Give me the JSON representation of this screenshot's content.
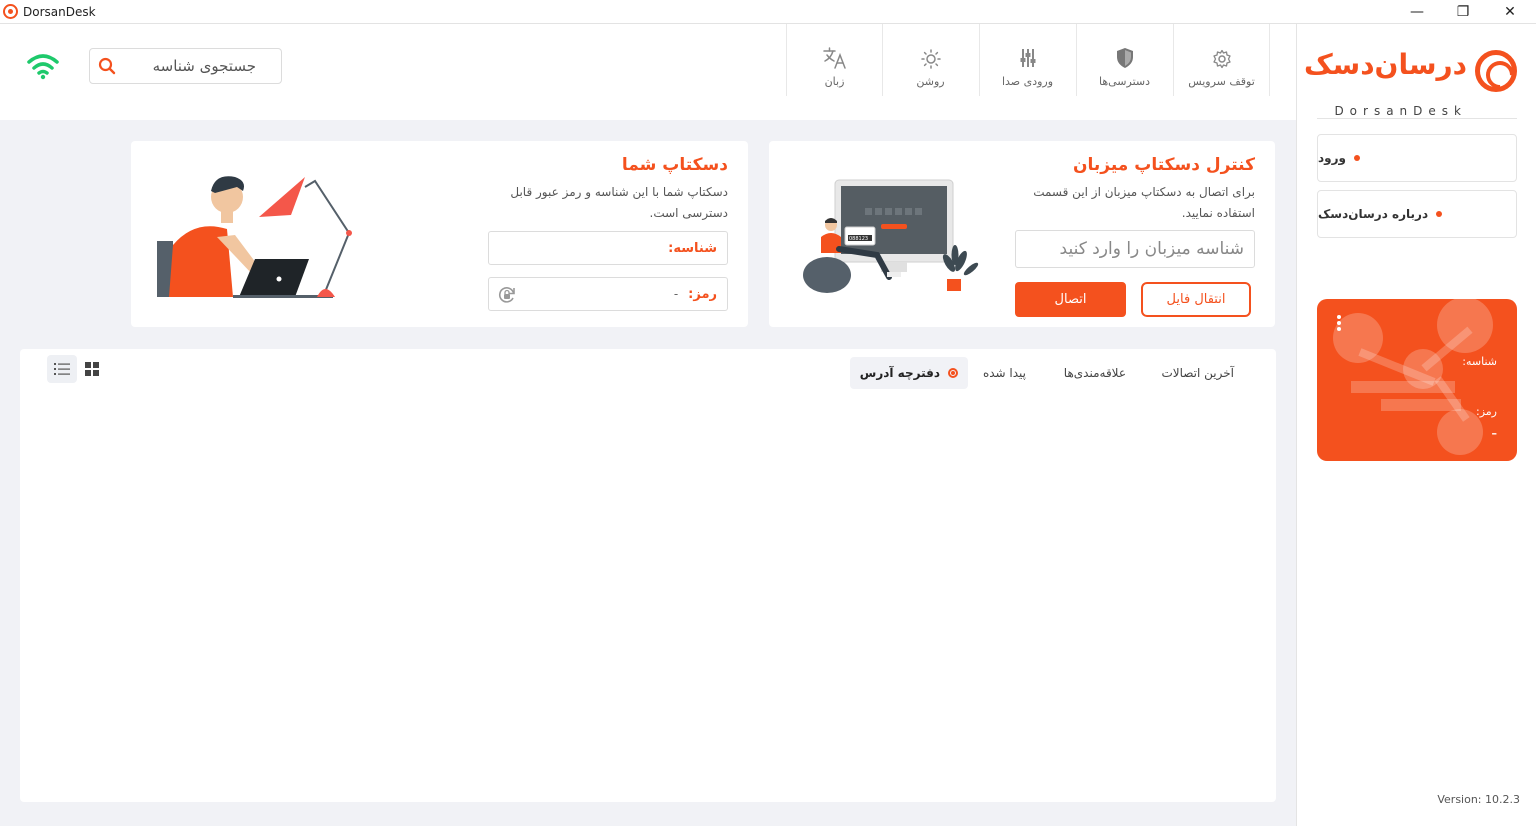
{
  "window": {
    "title": "DorsanDesk",
    "minimize": "—",
    "restore": "❐",
    "close": "✕"
  },
  "brand": {
    "name_fa": "درسان‌دسک",
    "name_en": "DorsanDesk"
  },
  "sidebar": {
    "items": [
      {
        "label": "ورود"
      },
      {
        "label": "درباره درسان‌دسک"
      }
    ],
    "id_card": {
      "id_label": "شناسه:",
      "password_label": "رمز:",
      "password_value": "–"
    },
    "version": "Version: 10.2.3"
  },
  "toolbar": {
    "search_placeholder": "جستجوی شناسه",
    "buttons": [
      {
        "label": "توقف سرویس",
        "icon": "gear-icon"
      },
      {
        "label": "دسترسی‌ها",
        "icon": "shield-icon"
      },
      {
        "label": "ورودی صدا",
        "icon": "sliders-icon"
      },
      {
        "label": "روشن",
        "icon": "sun-icon"
      },
      {
        "label": "زبان",
        "icon": "translate-icon"
      }
    ]
  },
  "host_control": {
    "title": "کنترل دسکتاپ میزبان",
    "description": "برای اتصال به دسکتاپ میزبان از این قسمت استفاده نمایید.",
    "input_placeholder": "شناسه میزبان را وارد کنید",
    "connect_label": "اتصال",
    "file_transfer_label": "انتقال فایل",
    "illustration_code": "088123"
  },
  "your_desktop": {
    "title": "دسکتاپ شما",
    "description": "دسکتاپ شما با این شناسه و رمز عبور قابل دسترسی است.",
    "id_label": "شناسه:",
    "password_label": "رمز:",
    "password_value": "-"
  },
  "tabs": [
    {
      "label": "آخرین اتصالات"
    },
    {
      "label": "علاقه‌مندی‌ها"
    },
    {
      "label": "پیدا شده"
    },
    {
      "label": "دفترچه آدرس"
    }
  ],
  "colors": {
    "accent": "#f4511e",
    "online": "#1ec96b"
  }
}
